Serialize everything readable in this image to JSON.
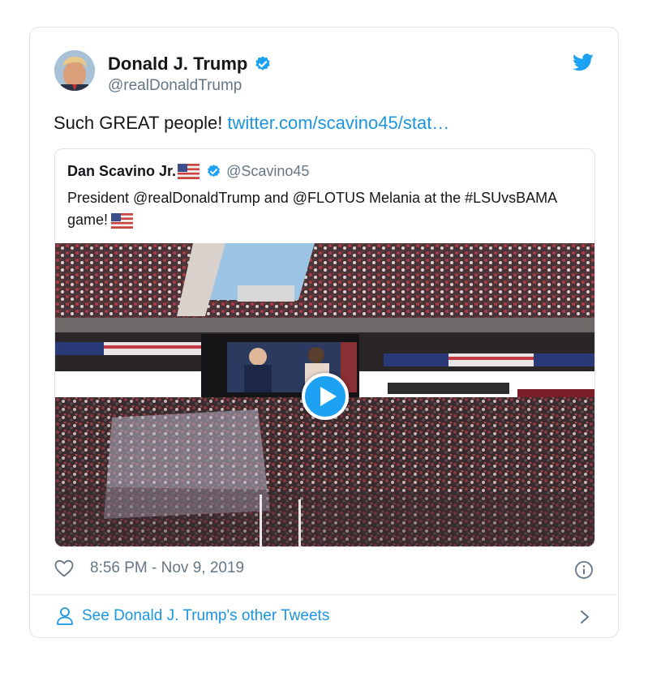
{
  "tweet": {
    "author_name": "Donald J. Trump",
    "author_handle": "@realDonaldTrump",
    "text": "Such GREAT people! ",
    "link_text": "twitter.com/scavino45/stat…",
    "timestamp": "8:56 PM - Nov 9, 2019"
  },
  "quoted": {
    "author_name": "Dan Scavino Jr.",
    "author_handle": "@Scavino45",
    "text": "President @realDonaldTrump and @FLOTUS Melania at the #LSUvsBAMA game!"
  },
  "footer": {
    "link_text": "See Donald J. Trump's other Tweets"
  },
  "icons": {
    "verified": "verified-badge-icon",
    "bird": "twitter-bird-icon",
    "heart": "heart-icon",
    "info": "info-icon",
    "person": "person-icon",
    "chevron": "chevron-right-icon",
    "play": "play-icon",
    "flag": "us-flag-icon"
  },
  "colors": {
    "twitter_blue": "#1da1f2",
    "link_blue": "#1b95e0",
    "secondary_text": "#657786",
    "border": "#dfe3e7"
  }
}
